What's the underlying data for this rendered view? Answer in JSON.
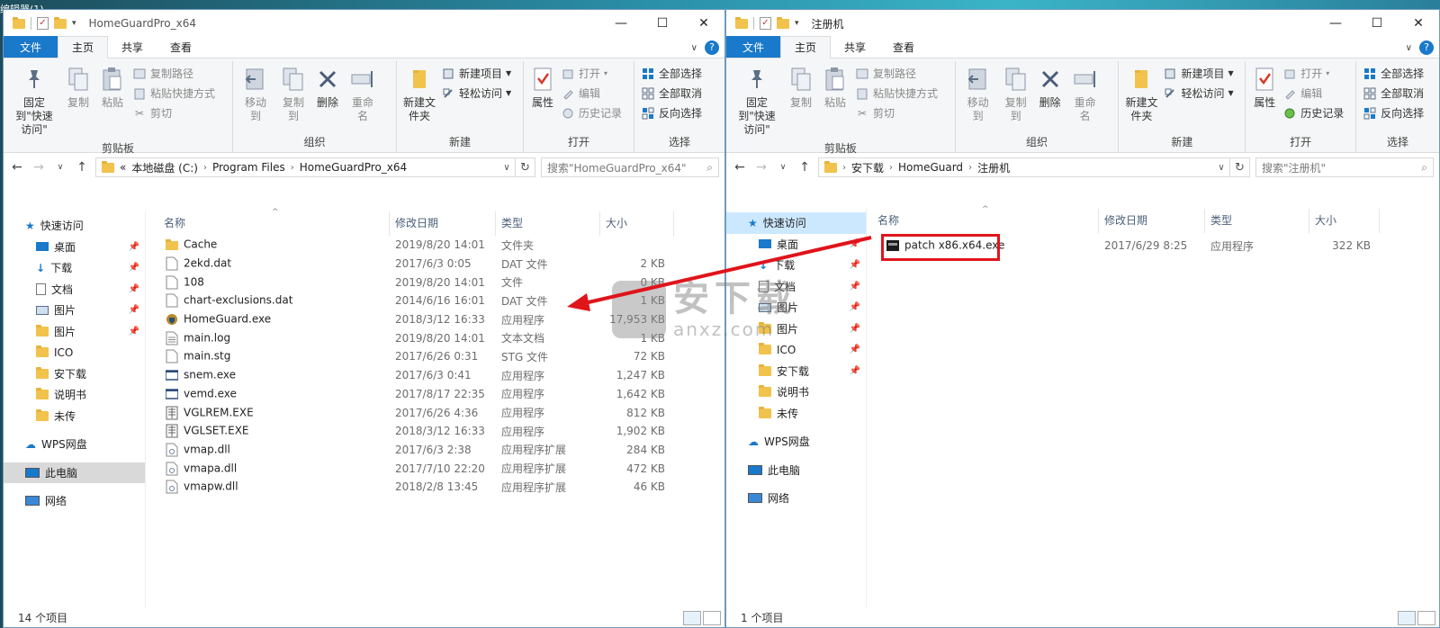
{
  "desktop": {
    "fragment_text": "编辑器(1)"
  },
  "left": {
    "title": "HomeGuardPro_x64",
    "tabs": {
      "file": "文件",
      "home": "主页",
      "share": "共享",
      "view": "查看"
    },
    "ribbon": {
      "clipboard": {
        "pin": "固定到\"快速访问\"",
        "copy": "复制",
        "paste": "粘贴",
        "copy_path": "复制路径",
        "paste_shortcut": "粘贴快捷方式",
        "cut": "剪切",
        "label": "剪贴板"
      },
      "organize": {
        "move_to": "移动到",
        "copy_to": "复制到",
        "delete": "删除",
        "rename": "重命名",
        "label": "组织"
      },
      "new": {
        "new_folder": "新建文件夹",
        "new_item": "新建项目",
        "easy_access": "轻松访问",
        "label": "新建"
      },
      "open": {
        "properties": "属性",
        "open": "打开",
        "edit": "编辑",
        "history": "历史记录",
        "label": "打开"
      },
      "select": {
        "select_all": "全部选择",
        "select_none": "全部取消",
        "invert": "反向选择",
        "label": "选择"
      }
    },
    "address": {
      "chevron": "«",
      "crumbs": [
        "本地磁盘 (C:)",
        "Program Files",
        "HomeGuardPro_x64"
      ]
    },
    "search_placeholder": "搜索\"HomeGuardPro_x64\"",
    "nav": {
      "quick_access": "快速访问",
      "items": [
        "桌面",
        "下载",
        "文档",
        "图片",
        "图片",
        "ICO",
        "安下载",
        "说明书",
        "未传"
      ],
      "wps": "WPS网盘",
      "this_pc": "此电脑",
      "network": "网络"
    },
    "columns": {
      "name": "名称",
      "date": "修改日期",
      "type": "类型",
      "size": "大小"
    },
    "files": [
      {
        "name": "Cache",
        "date": "2019/8/20 14:01",
        "type": "文件夹",
        "size": "",
        "icon": "folder-icon"
      },
      {
        "name": "2ekd.dat",
        "date": "2017/6/3 0:05",
        "type": "DAT 文件",
        "size": "2 KB",
        "icon": "file-icon"
      },
      {
        "name": "108",
        "date": "2019/8/20 14:01",
        "type": "文件",
        "size": "0 KB",
        "icon": "file-icon"
      },
      {
        "name": "chart-exclusions.dat",
        "date": "2014/6/16 16:01",
        "type": "DAT 文件",
        "size": "1 KB",
        "icon": "file-icon"
      },
      {
        "name": "HomeGuard.exe",
        "date": "2018/3/12 16:33",
        "type": "应用程序",
        "size": "17,953 KB",
        "icon": "app-shield-icon"
      },
      {
        "name": "main.log",
        "date": "2019/8/20 14:01",
        "type": "文本文档",
        "size": "1 KB",
        "icon": "text-file-icon"
      },
      {
        "name": "main.stg",
        "date": "2017/6/26 0:31",
        "type": "STG 文件",
        "size": "72 KB",
        "icon": "file-icon"
      },
      {
        "name": "snem.exe",
        "date": "2017/6/3 0:41",
        "type": "应用程序",
        "size": "1,247 KB",
        "icon": "exe-window-icon"
      },
      {
        "name": "vemd.exe",
        "date": "2017/8/17 22:35",
        "type": "应用程序",
        "size": "1,642 KB",
        "icon": "exe-window-icon"
      },
      {
        "name": "VGLREM.EXE",
        "date": "2017/6/26 4:36",
        "type": "应用程序",
        "size": "812 KB",
        "icon": "exe-grid-icon"
      },
      {
        "name": "VGLSET.EXE",
        "date": "2018/3/12 16:33",
        "type": "应用程序",
        "size": "1,902 KB",
        "icon": "exe-grid-icon"
      },
      {
        "name": "vmap.dll",
        "date": "2017/6/3 2:38",
        "type": "应用程序扩展",
        "size": "284 KB",
        "icon": "dll-icon"
      },
      {
        "name": "vmapa.dll",
        "date": "2017/7/10 22:20",
        "type": "应用程序扩展",
        "size": "472 KB",
        "icon": "dll-icon"
      },
      {
        "name": "vmapw.dll",
        "date": "2018/2/8 13:45",
        "type": "应用程序扩展",
        "size": "46 KB",
        "icon": "dll-icon"
      }
    ],
    "status": "14 个项目"
  },
  "right": {
    "title": "注册机",
    "tabs": {
      "file": "文件",
      "home": "主页",
      "share": "共享",
      "view": "查看"
    },
    "ribbon": {
      "clipboard": {
        "pin": "固定到\"快速访问\"",
        "copy": "复制",
        "paste": "粘贴",
        "copy_path": "复制路径",
        "paste_shortcut": "粘贴快捷方式",
        "cut": "剪切",
        "label": "剪贴板"
      },
      "organize": {
        "move_to": "移动到",
        "copy_to": "复制到",
        "delete": "删除",
        "rename": "重命名",
        "label": "组织"
      },
      "new": {
        "new_folder": "新建文件夹",
        "new_item": "新建项目",
        "easy_access": "轻松访问",
        "label": "新建"
      },
      "open": {
        "properties": "属性",
        "open": "打开",
        "edit": "编辑",
        "history": "历史记录",
        "label": "打开"
      },
      "select": {
        "select_all": "全部选择",
        "select_none": "全部取消",
        "invert": "反向选择",
        "label": "选择"
      }
    },
    "address": {
      "crumbs": [
        "安下载",
        "HomeGuard",
        "注册机"
      ]
    },
    "search_placeholder": "搜索\"注册机\"",
    "nav": {
      "quick_access": "快速访问",
      "items": [
        "桌面",
        "下载",
        "文档",
        "图片",
        "图片",
        "ICO",
        "安下载",
        "说明书",
        "未传"
      ],
      "wps": "WPS网盘",
      "this_pc": "此电脑",
      "network": "网络"
    },
    "columns": {
      "name": "名称",
      "date": "修改日期",
      "type": "类型",
      "size": "大小"
    },
    "files": [
      {
        "name": "patch x86.x64.exe",
        "date": "2017/6/29 8:25",
        "type": "应用程序",
        "size": "322 KB",
        "icon": "patch-exe-icon"
      }
    ],
    "status": "1 个项目"
  },
  "watermark": {
    "cn": "安下载",
    "en": "anxz.com"
  },
  "colors": {
    "accent": "#1979ca",
    "highlight": "#e0141b",
    "arrow": "#e0141b",
    "selection": "#cce8ff"
  }
}
